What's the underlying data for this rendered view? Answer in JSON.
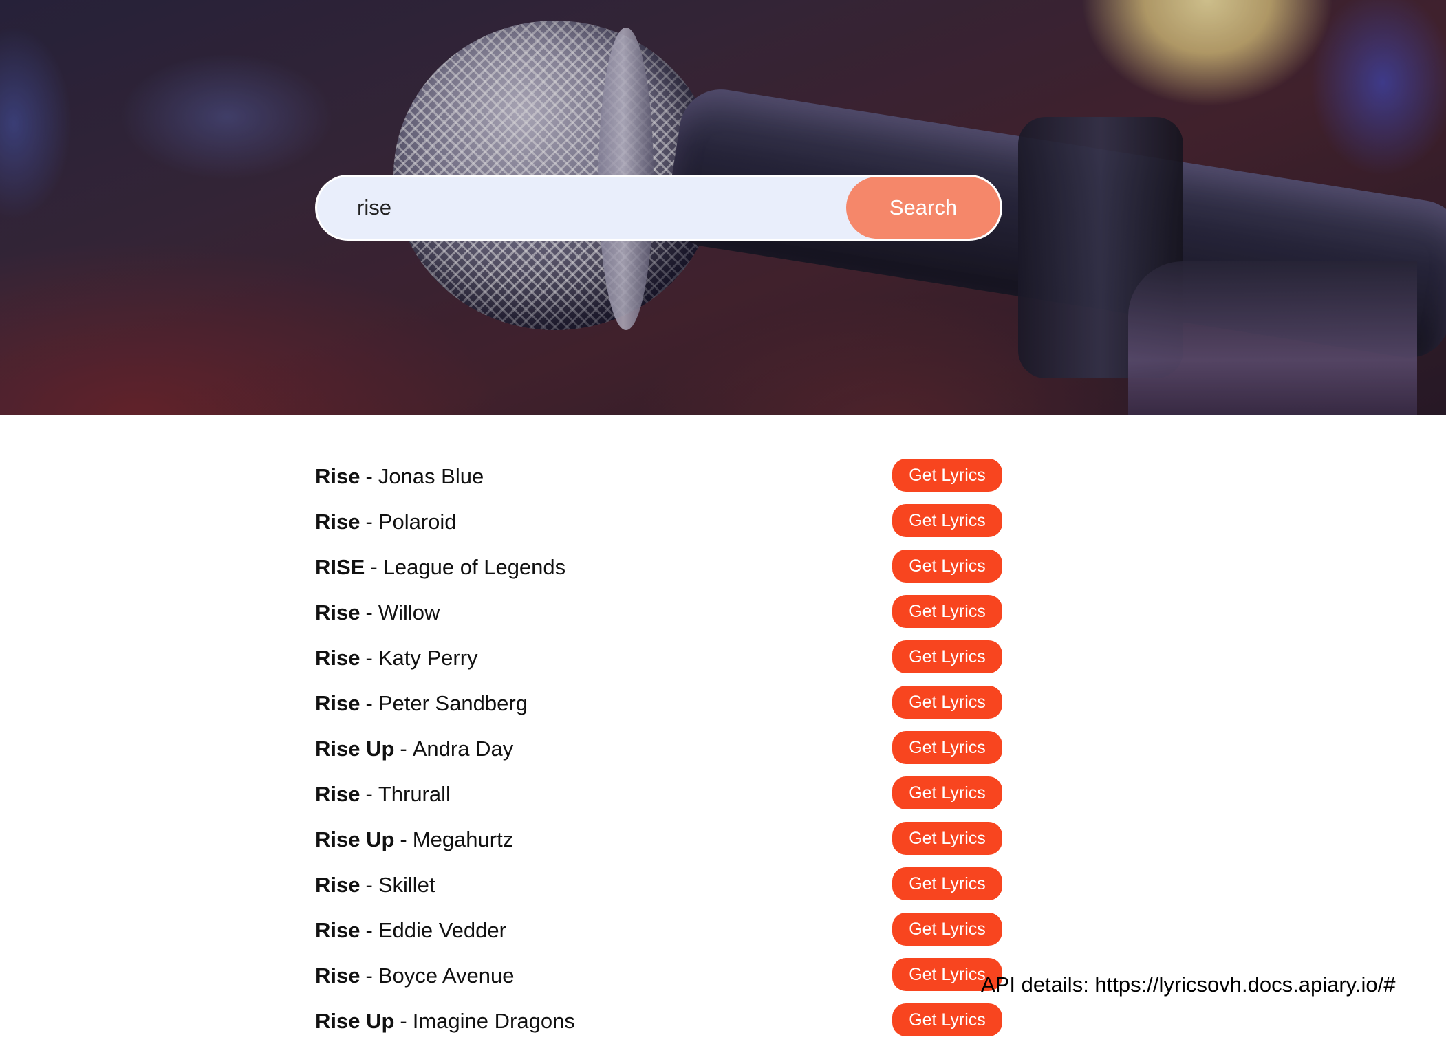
{
  "search": {
    "value": "rise",
    "button_label": "Search"
  },
  "results": [
    {
      "title": "Rise",
      "artist": "Jonas Blue",
      "button_label": "Get Lyrics"
    },
    {
      "title": "Rise",
      "artist": "Polaroid",
      "button_label": "Get Lyrics"
    },
    {
      "title": "RISE",
      "artist": "League of Legends",
      "button_label": "Get Lyrics"
    },
    {
      "title": "Rise",
      "artist": "Willow",
      "button_label": "Get Lyrics"
    },
    {
      "title": "Rise",
      "artist": "Katy Perry",
      "button_label": "Get Lyrics"
    },
    {
      "title": "Rise",
      "artist": "Peter Sandberg",
      "button_label": "Get Lyrics"
    },
    {
      "title": "Rise Up",
      "artist": "Andra Day",
      "button_label": "Get Lyrics"
    },
    {
      "title": "Rise",
      "artist": "Thrurall",
      "button_label": "Get Lyrics"
    },
    {
      "title": "Rise Up",
      "artist": "Megahurtz",
      "button_label": "Get Lyrics"
    },
    {
      "title": "Rise",
      "artist": "Skillet",
      "button_label": "Get Lyrics"
    },
    {
      "title": "Rise",
      "artist": "Eddie Vedder",
      "button_label": "Get Lyrics"
    },
    {
      "title": "Rise",
      "artist": "Boyce Avenue",
      "button_label": "Get Lyrics"
    },
    {
      "title": "Rise Up",
      "artist": "Imagine Dragons",
      "button_label": "Get Lyrics"
    }
  ],
  "separator": "-",
  "footer": {
    "api_note": "API details: https://lyricsovh.docs.apiary.io/#"
  },
  "colors": {
    "search_button": "#f5876a",
    "lyrics_button": "#f8451f",
    "search_field": "#e9eefb"
  }
}
